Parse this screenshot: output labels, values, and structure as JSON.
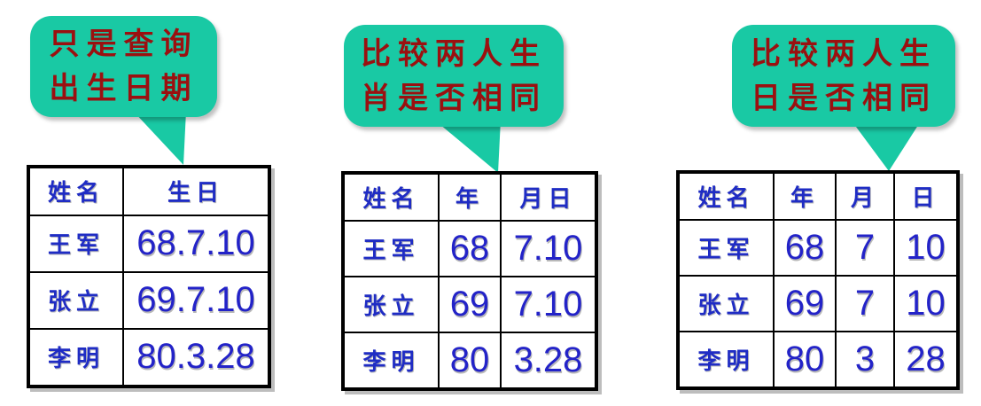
{
  "callouts": [
    {
      "line1": "只是查询",
      "line2": "出生日期"
    },
    {
      "line1": "比较两人生",
      "line2": "肖是否相同"
    },
    {
      "line1": "比较两人生",
      "line2": "日是否相同"
    }
  ],
  "tables": [
    {
      "headers": [
        "姓名",
        "生日"
      ],
      "rows": [
        [
          "王军",
          "68.7.10"
        ],
        [
          "张立",
          "69.7.10"
        ],
        [
          "李明",
          "80.3.28"
        ]
      ]
    },
    {
      "headers": [
        "姓名",
        "年",
        "月日"
      ],
      "rows": [
        [
          "王军",
          "68",
          "7.10"
        ],
        [
          "张立",
          "69",
          "7.10"
        ],
        [
          "李明",
          "80",
          "3.28"
        ]
      ]
    },
    {
      "headers": [
        "姓名",
        "年",
        "月",
        "日"
      ],
      "rows": [
        [
          "王军",
          "68",
          "7",
          "10"
        ],
        [
          "张立",
          "69",
          "7",
          "10"
        ],
        [
          "李明",
          "80",
          "3",
          "28"
        ]
      ]
    }
  ],
  "colors": {
    "callout_fill": "#19c9a4",
    "callout_text": "#9b1010",
    "table_text": "#1f2cc4"
  }
}
